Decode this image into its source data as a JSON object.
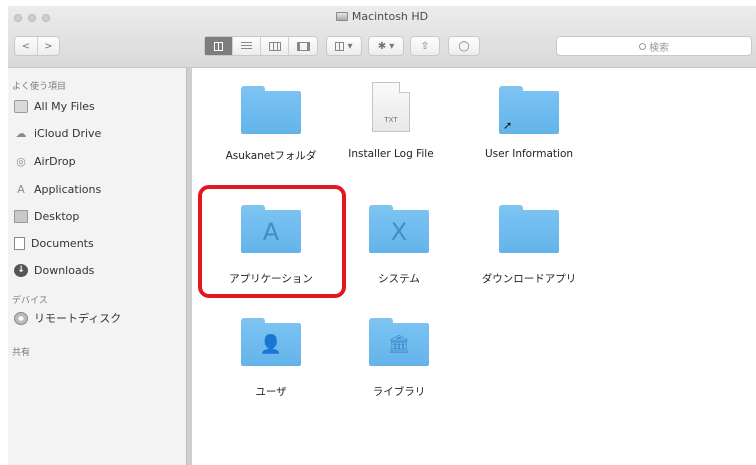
{
  "window": {
    "title": "Macintosh HD"
  },
  "toolbar": {
    "back_label": "<",
    "forward_label": ">",
    "arrange_label": "▾",
    "action_label": "✱ ▾",
    "share_label": "⇧",
    "tag_label": "◯",
    "search_placeholder": "検索"
  },
  "sidebar": {
    "sections": [
      {
        "title": "よく使う項目",
        "items": [
          {
            "label": "All My Files",
            "icon": "all-my-files-icon"
          },
          {
            "label": "iCloud Drive",
            "icon": "cloud-icon"
          },
          {
            "label": "AirDrop",
            "icon": "airdrop-icon"
          },
          {
            "label": "Applications",
            "icon": "applications-icon"
          },
          {
            "label": "Desktop",
            "icon": "desktop-icon"
          },
          {
            "label": "Documents",
            "icon": "documents-icon"
          },
          {
            "label": "Downloads",
            "icon": "downloads-icon"
          }
        ]
      },
      {
        "title": "デバイス",
        "items": [
          {
            "label": "リモートディスク",
            "icon": "remote-disk-icon"
          }
        ]
      },
      {
        "title": "共有",
        "items": []
      }
    ]
  },
  "content": {
    "items": [
      {
        "name": "Asukanetフォルダ",
        "kind": "folder"
      },
      {
        "name": "Installer Log File",
        "kind": "document",
        "ext": "TXT"
      },
      {
        "name": "User Information",
        "kind": "alias-folder"
      },
      {
        "name": "アプリケーション",
        "kind": "applications-folder",
        "glyph": "A"
      },
      {
        "name": "システム",
        "kind": "system-folder",
        "glyph": "X"
      },
      {
        "name": "ダウンロードアプリ",
        "kind": "folder"
      },
      {
        "name": "ユーザ",
        "kind": "users-folder",
        "glyph": "👤"
      },
      {
        "name": "ライブラリ",
        "kind": "library-folder",
        "glyph": "🏛"
      }
    ]
  },
  "colors": {
    "folder_blue": "#6cb9ec",
    "highlight_red": "#e3171e",
    "sidebar_bg": "#f3f3f3"
  }
}
